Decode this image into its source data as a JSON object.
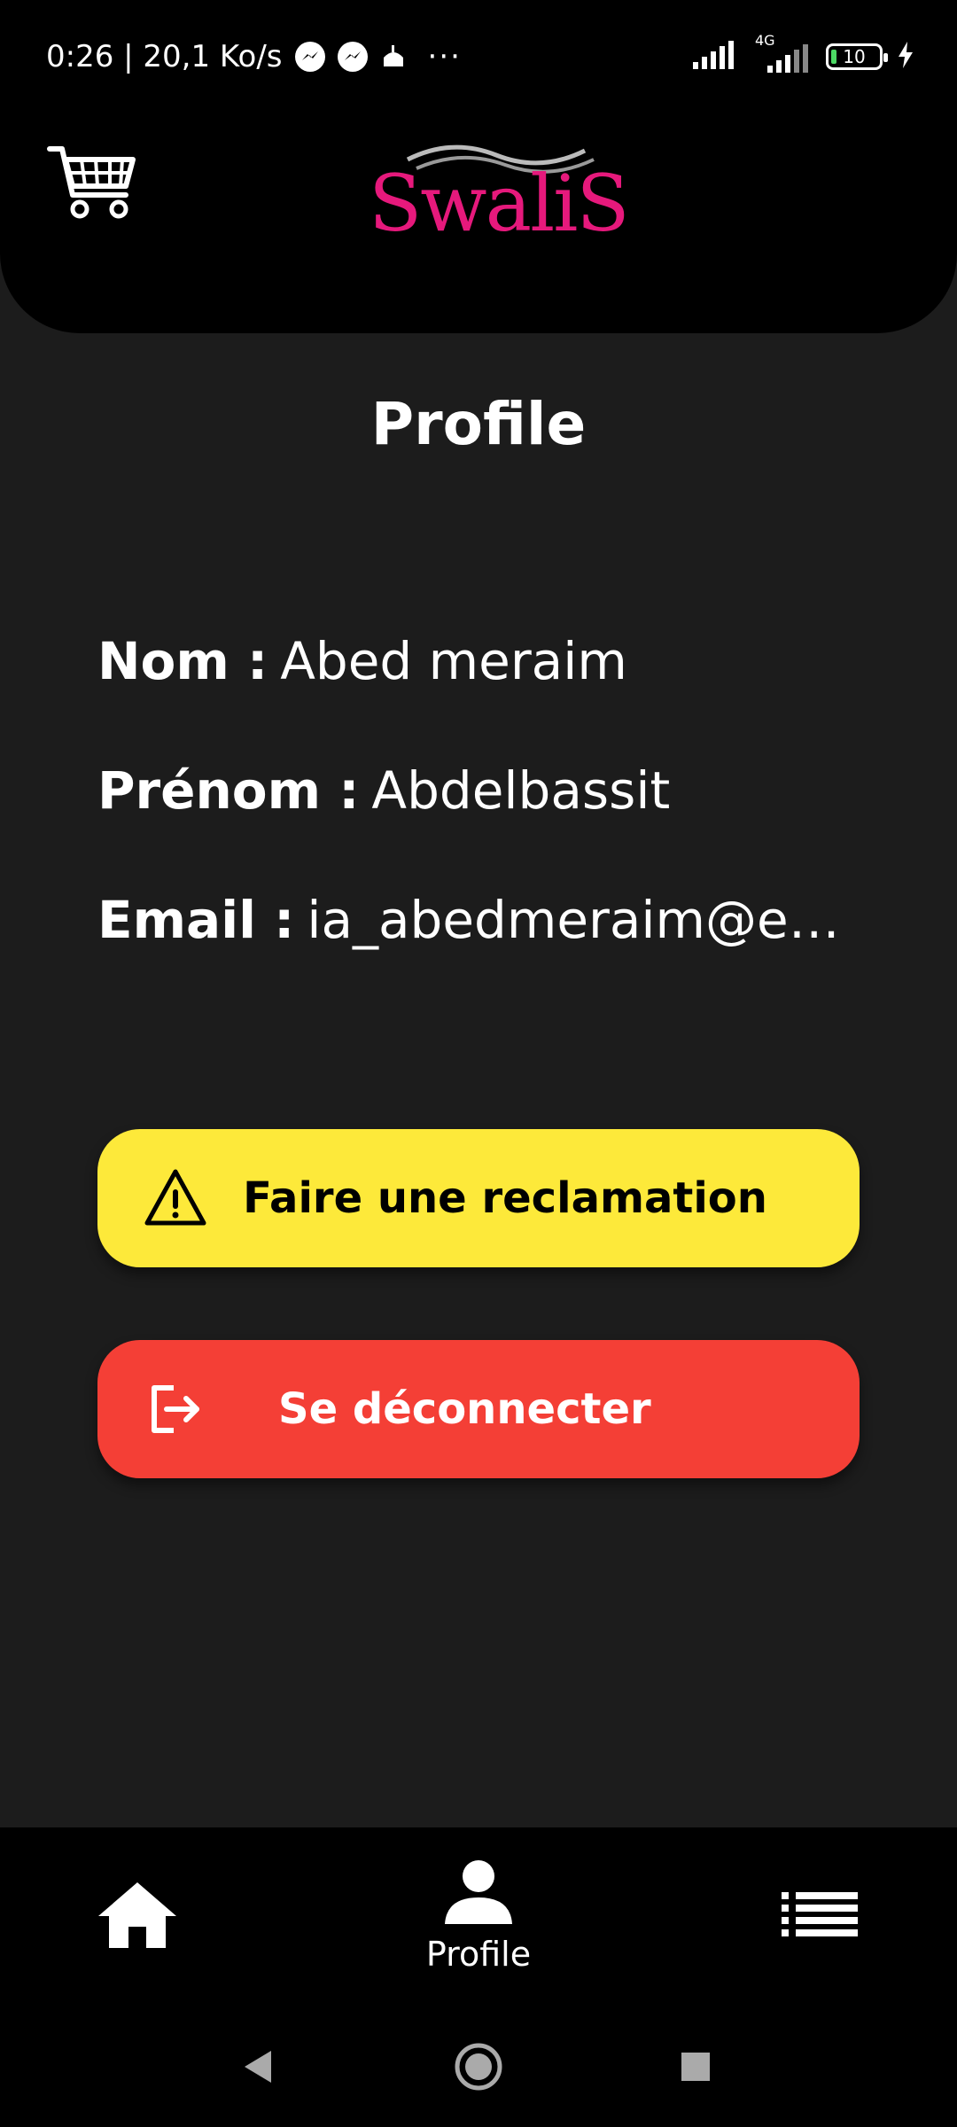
{
  "status_bar": {
    "time_speed": "0:26 | 20,1 Ko/s",
    "more": "···",
    "network": "4G",
    "battery": "10"
  },
  "header": {
    "logo_text": "SwaliS",
    "cart_icon": "cart-icon"
  },
  "page": {
    "title": "Profile"
  },
  "profile": {
    "nom_label": "Nom :",
    "nom_value": "Abed meraim",
    "prenom_label": "Prénom :",
    "prenom_value": "Abdelbassit",
    "email_label": "Email :",
    "email_value": "ia_abedmeraim@esi.…"
  },
  "actions": {
    "reclamation_label": "Faire une reclamation",
    "reclamation_color": "#fde93a",
    "logout_label": "Se déconnecter",
    "logout_color": "#f43f36"
  },
  "bottom_nav": {
    "items": [
      {
        "icon": "home-icon",
        "label": ""
      },
      {
        "icon": "person-icon",
        "label": "Profile"
      },
      {
        "icon": "list-icon",
        "label": ""
      }
    ]
  },
  "system_nav": {
    "back": "back-icon",
    "home": "home-circle-icon",
    "recents": "recents-icon"
  }
}
